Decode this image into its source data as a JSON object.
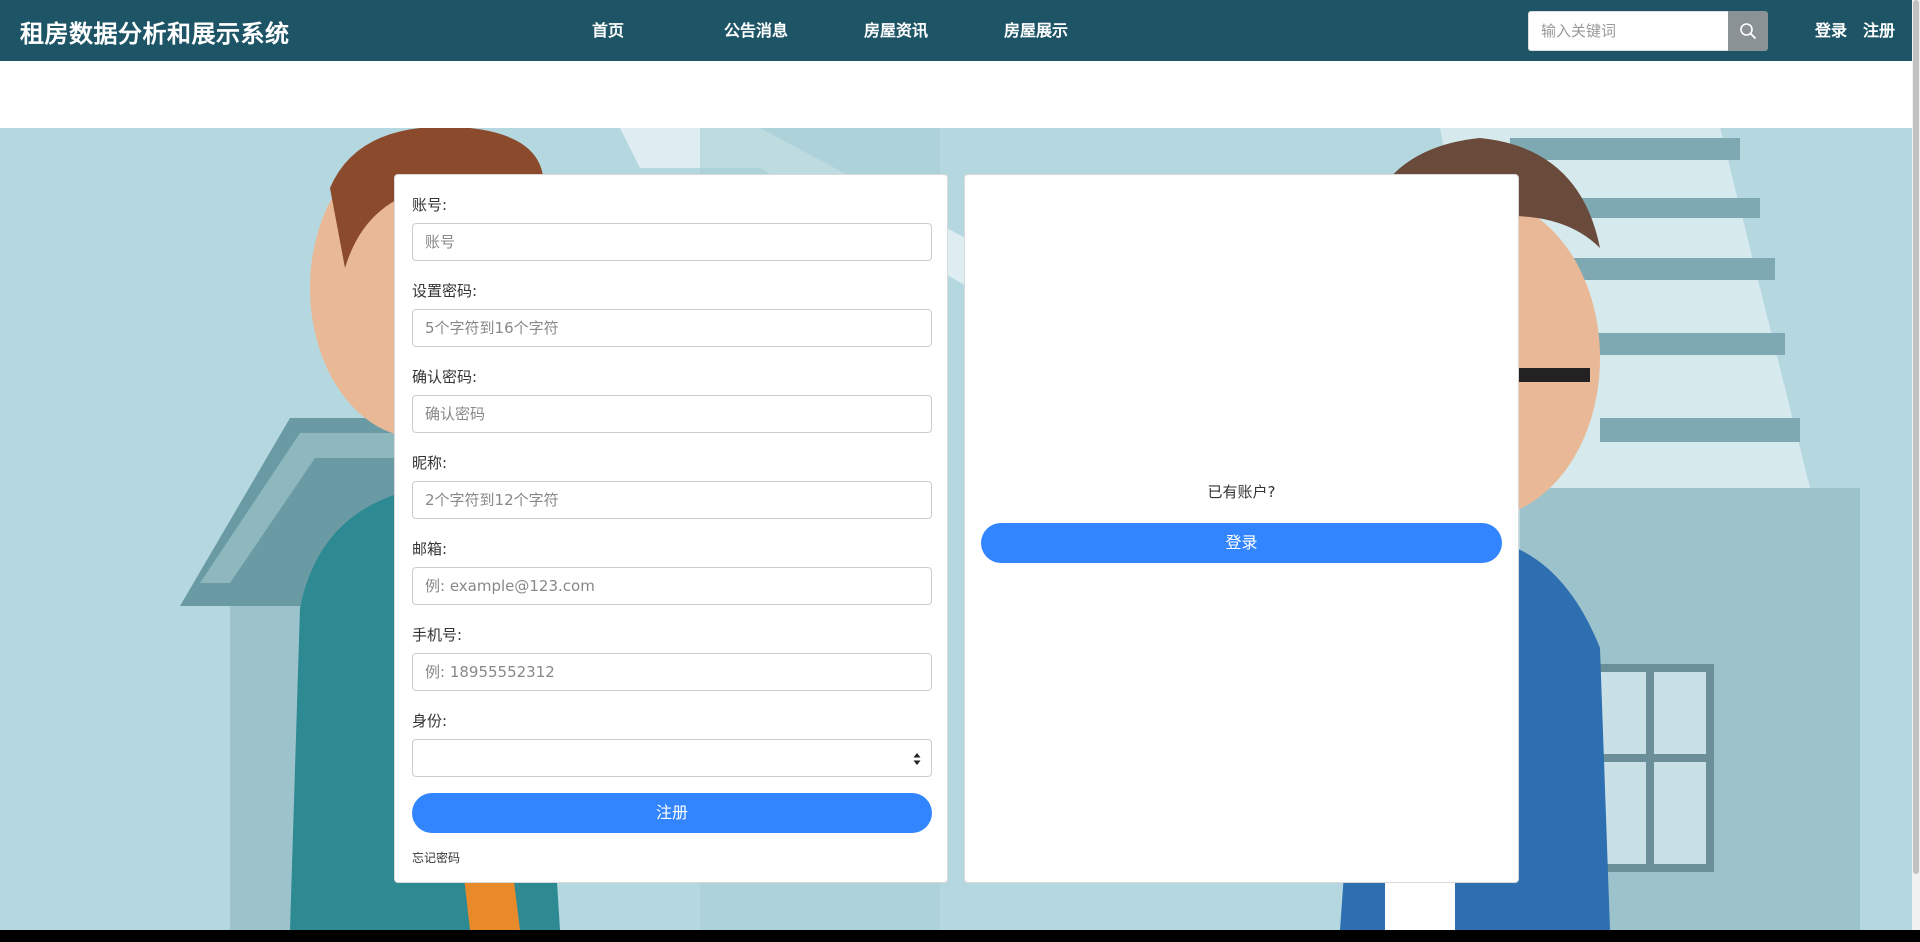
{
  "navbar": {
    "brand": "租房数据分析和展示系统",
    "links": [
      "首页",
      "公告消息",
      "房屋资讯",
      "房屋展示"
    ],
    "search_placeholder": "输入关键词",
    "login": "登录",
    "register": "注册"
  },
  "register_form": {
    "fields": [
      {
        "label": "账号:",
        "placeholder": "账号"
      },
      {
        "label": "设置密码:",
        "placeholder": "5个字符到16个字符"
      },
      {
        "label": "确认密码:",
        "placeholder": "确认密码"
      },
      {
        "label": "昵称:",
        "placeholder": "2个字符到12个字符"
      },
      {
        "label": "邮箱:",
        "placeholder": "例: example@123.com"
      },
      {
        "label": "手机号:",
        "placeholder": "例: 18955552312"
      }
    ],
    "role_label": "身份:",
    "role_value": "",
    "submit_label": "注册",
    "forgot_label": "忘记密码"
  },
  "login_panel": {
    "prompt": "已有账户?",
    "login_label": "登录"
  },
  "colors": {
    "navbar": "#1d5466",
    "primary": "#3385ff",
    "background": "#b5d8e0"
  },
  "icons": {
    "search": "search-icon",
    "select_caret": "sort-caret-icon"
  }
}
